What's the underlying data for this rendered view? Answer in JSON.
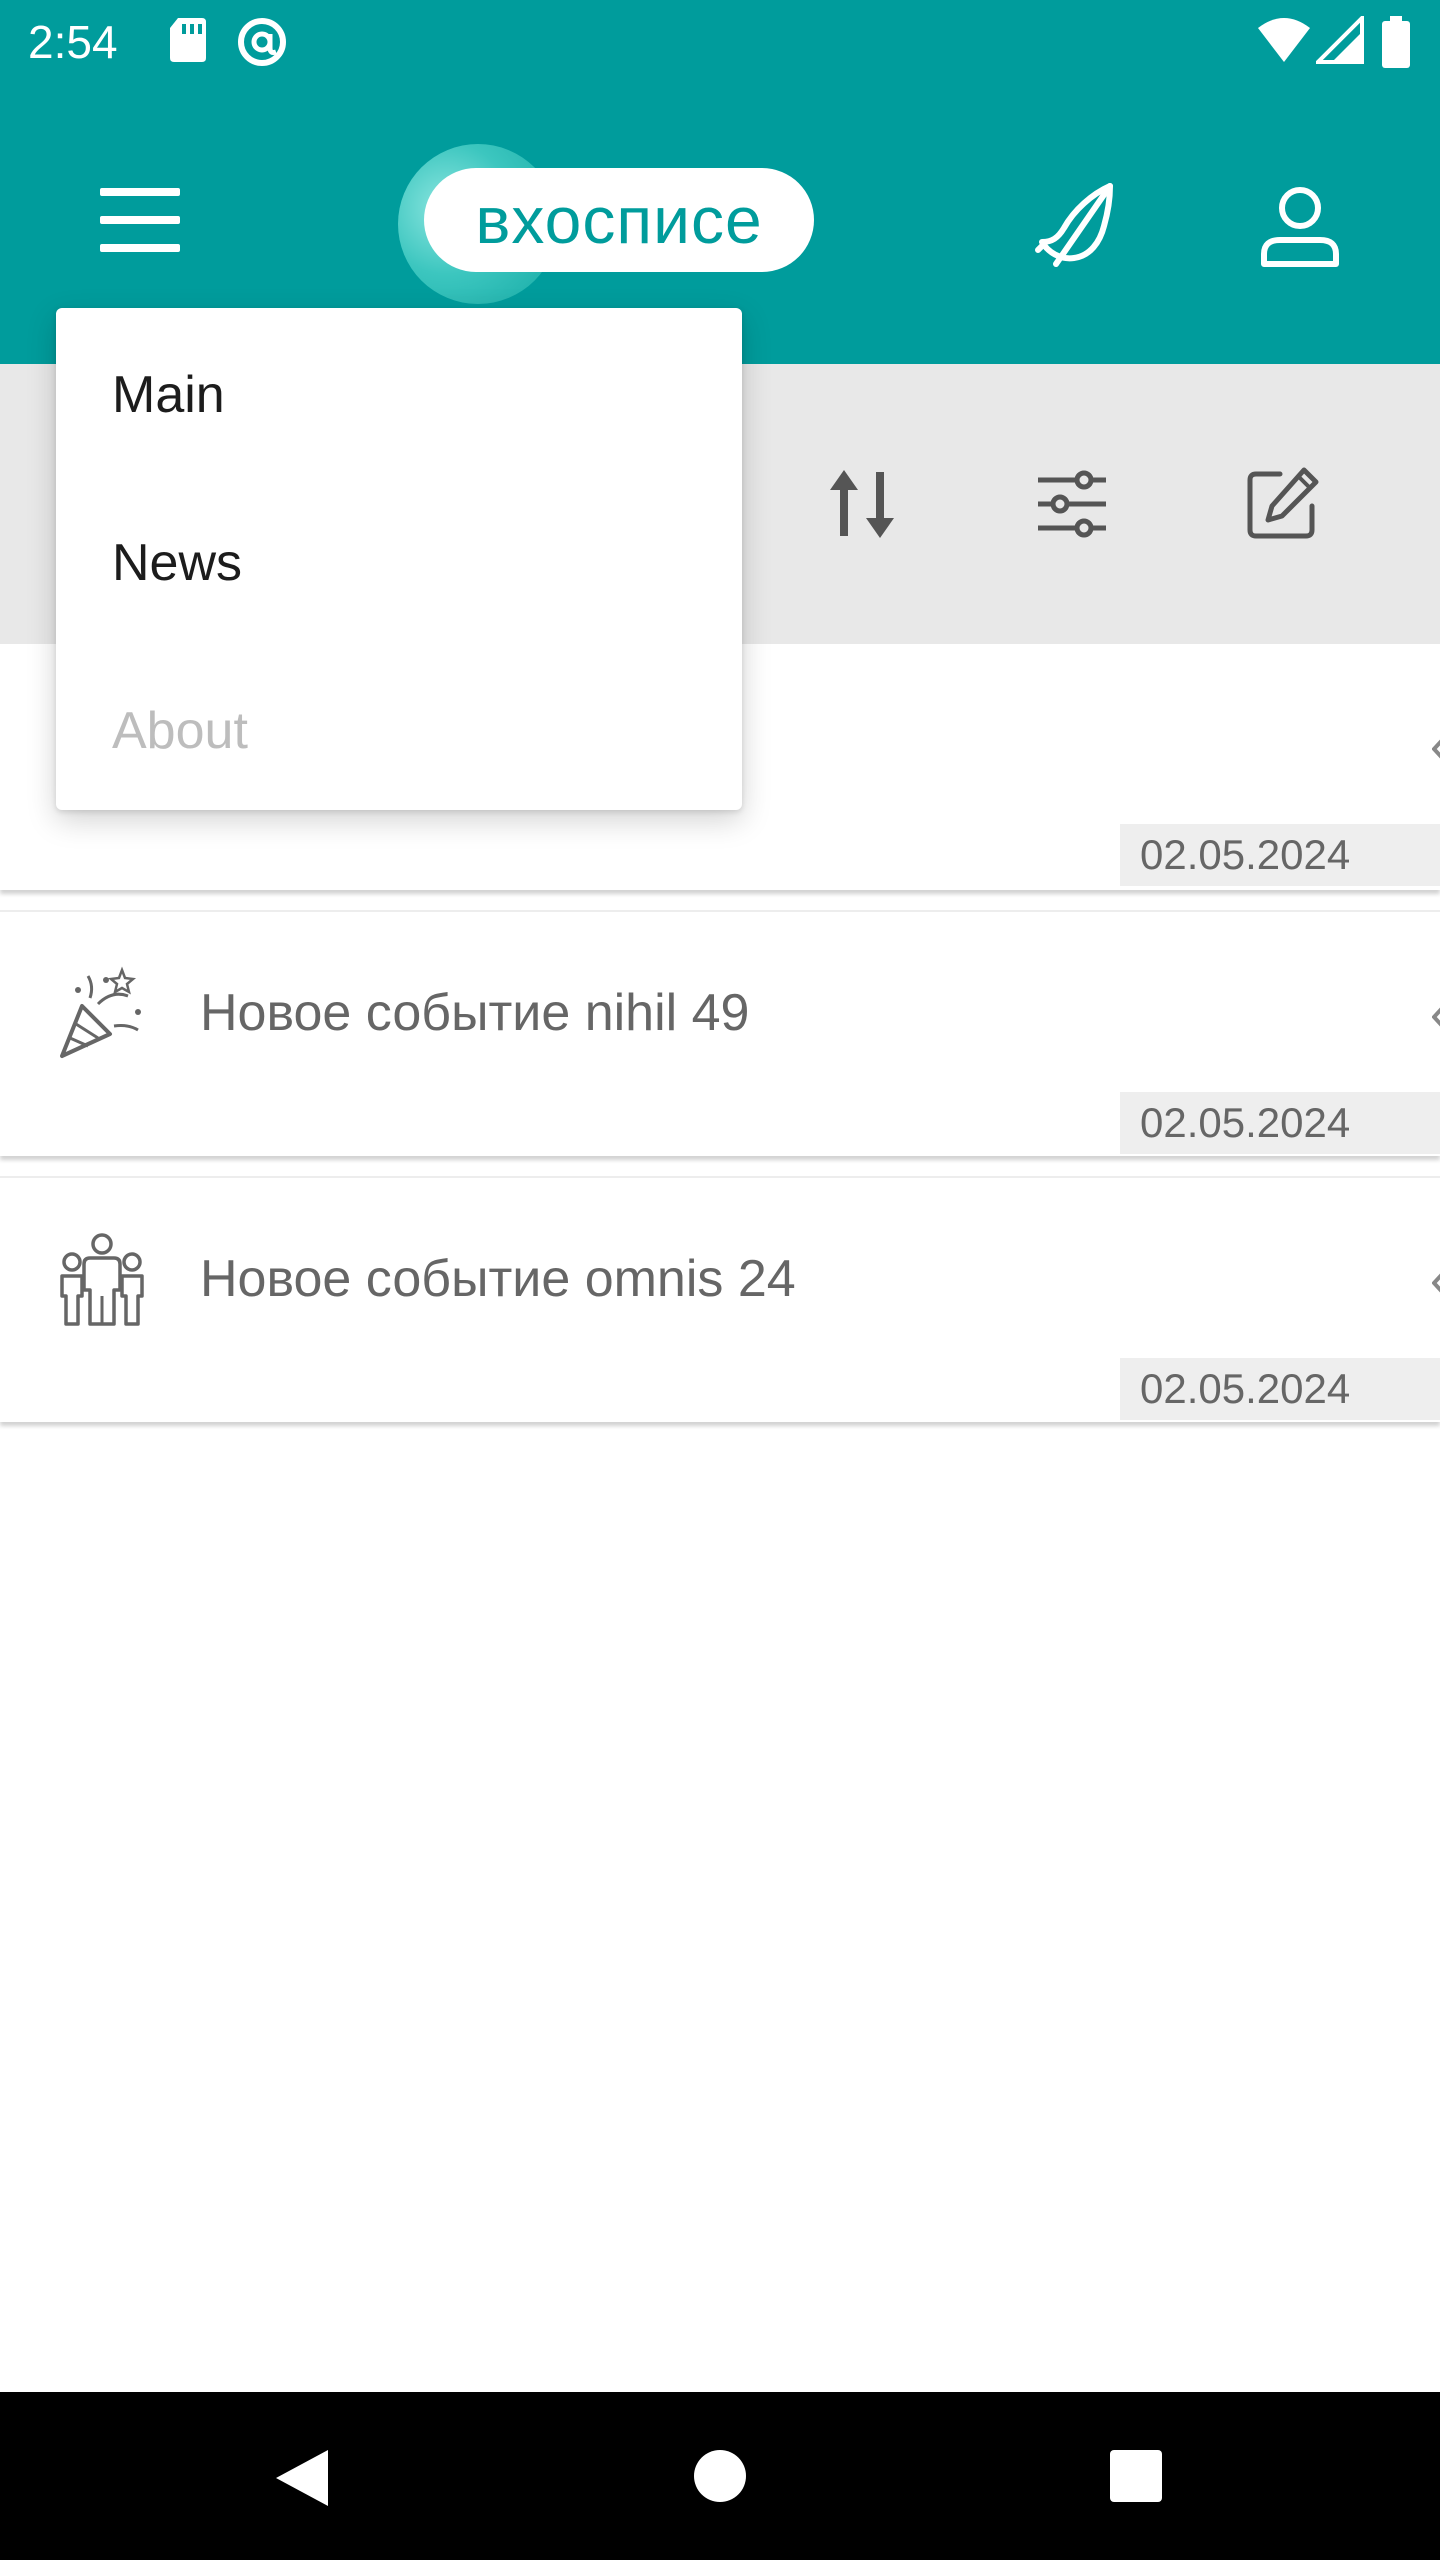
{
  "status_bar": {
    "time": "2:54",
    "icons": [
      "sd-card-icon",
      "at-sign-icon",
      "wifi-icon",
      "signal-icon",
      "battery-icon"
    ]
  },
  "app_bar": {
    "logo_text": "вхосписе",
    "icons": [
      "menu-icon",
      "feather-icon",
      "user-icon"
    ],
    "background_color": "#009c9c"
  },
  "toolbar": {
    "icons": [
      "sort-icon",
      "filter-sliders-icon",
      "edit-icon"
    ]
  },
  "dropdown": {
    "items": [
      {
        "label": "Main",
        "enabled": true
      },
      {
        "label": "News",
        "enabled": true
      },
      {
        "label": "About",
        "enabled": false
      }
    ]
  },
  "events": [
    {
      "title": "",
      "date": "02.05.2024",
      "icon": "unknown-icon"
    },
    {
      "title": "Новое событие nihil 49",
      "date": "02.05.2024",
      "icon": "party-popper-icon"
    },
    {
      "title": "Новое событие omnis 24",
      "date": "02.05.2024",
      "icon": "family-icon"
    }
  ],
  "nav_bar": {
    "buttons": [
      "back-icon",
      "home-icon",
      "recents-icon"
    ]
  }
}
